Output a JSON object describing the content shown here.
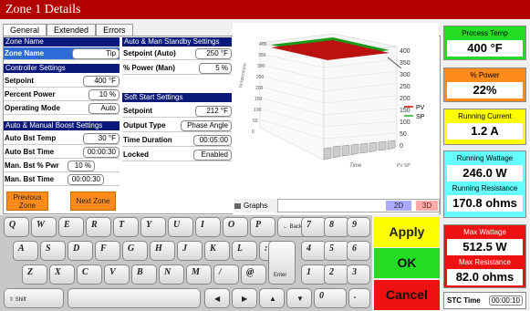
{
  "title": "Zone 1 Details",
  "tabs": [
    "General",
    "Extended",
    "Errors"
  ],
  "sections": {
    "zone_name": "Zone Name",
    "controller": "Controller Settings",
    "boost": "Auto & Manual Boost Settings",
    "standby": "Auto & Man Standby Settings",
    "soft_start": "Soft Start Settings"
  },
  "fields": {
    "zone_name": {
      "label": "Zone Name",
      "value": "Tip"
    },
    "setpoint": {
      "label": "Setpoint",
      "value": "400 °F"
    },
    "percent_power": {
      "label": "Percent Power",
      "value": "10 %"
    },
    "operating_mode": {
      "label": "Operating Mode",
      "value": "Auto"
    },
    "auto_bst_temp": {
      "label": "Auto Bst Temp",
      "value": "30 °F"
    },
    "auto_bst_time": {
      "label": "Auto Bst Time",
      "value": "00:00:30"
    },
    "man_bst_pwr": {
      "label": "Man. Bst % Pwr",
      "value": "10 %"
    },
    "man_bst_time": {
      "label": "Man. Bst Time",
      "value": "00:00:30"
    },
    "setpoint_auto": {
      "label": "Setpoint (Auto)",
      "value": "250 °F"
    },
    "power_man": {
      "label": "% Power (Man)",
      "value": "5 %"
    },
    "ss_setpoint": {
      "label": "Setpoint",
      "value": "212 °F"
    },
    "output_type": {
      "label": "Output Type",
      "value": "Phase Angle"
    },
    "time_duration": {
      "label": "Time Duration",
      "value": "00:05:00"
    },
    "locked": {
      "label": "Locked",
      "value": "Enabled"
    }
  },
  "buttons": {
    "previous": "Previous Zone",
    "next": "Next Zone"
  },
  "graph": {
    "label": "Graphs",
    "btn_2d": "2D",
    "btn_3d": "3D",
    "y_ticks_left": [
      "400",
      "350",
      "300",
      "250",
      "200",
      "150",
      "100",
      "50",
      "0"
    ],
    "y_ticks_right": [
      "400",
      "350",
      "300",
      "250",
      "200",
      "150",
      "100",
      "50",
      "0"
    ],
    "ylabel": "Temperature",
    "xlabel": "Time",
    "zlabel": "PV SP",
    "legend": [
      {
        "name": "PV",
        "color": "#cc0000"
      },
      {
        "name": "SP",
        "color": "#22aa22"
      }
    ]
  },
  "side": {
    "process_temp": {
      "label": "Process Temp",
      "value": "400 °F",
      "color": "#22dd22"
    },
    "power": {
      "label": "% Power",
      "value": "22%",
      "color": "#ff8c1a"
    },
    "current": {
      "label": "Running Current",
      "value": "1.2 A",
      "color": "#ffff00"
    },
    "wattage": {
      "label": "Running Wattage",
      "value": "246.0 W",
      "color": "#66ffff"
    },
    "resistance": {
      "label": "Running Resistance",
      "value": "170.8 ohms",
      "color": "#66ffff"
    },
    "max_wattage": {
      "label": "Max Wattage",
      "value": "512.5 W",
      "color": "#ee1111"
    },
    "max_resistance": {
      "label": "Max Resistance",
      "value": "82.0 ohms",
      "color": "#ee1111"
    },
    "stc": {
      "label": "STC Time",
      "value": "00:00:10"
    }
  },
  "actions": {
    "apply": "Apply",
    "ok": "OK",
    "cancel": "Cancel"
  },
  "keyboard": {
    "row1": [
      "Q",
      "W",
      "E",
      "R",
      "T",
      "Y",
      "U",
      "I",
      "O",
      "P"
    ],
    "backspace": "← Backspace",
    "row2": [
      "A",
      "S",
      "D",
      "F",
      "G",
      "H",
      "J",
      "K",
      "L",
      ":"
    ],
    "row3": [
      "Z",
      "X",
      "C",
      "V",
      "B",
      "N",
      "M",
      "/",
      "@"
    ],
    "enter": "Enter",
    "shift": "⇧ Shift",
    "numpad": [
      "7",
      "8",
      "9",
      "4",
      "5",
      "6",
      "1",
      "2",
      "3",
      "0",
      "."
    ],
    "arrows": [
      "◀",
      "▶",
      "▲",
      "▼"
    ]
  }
}
